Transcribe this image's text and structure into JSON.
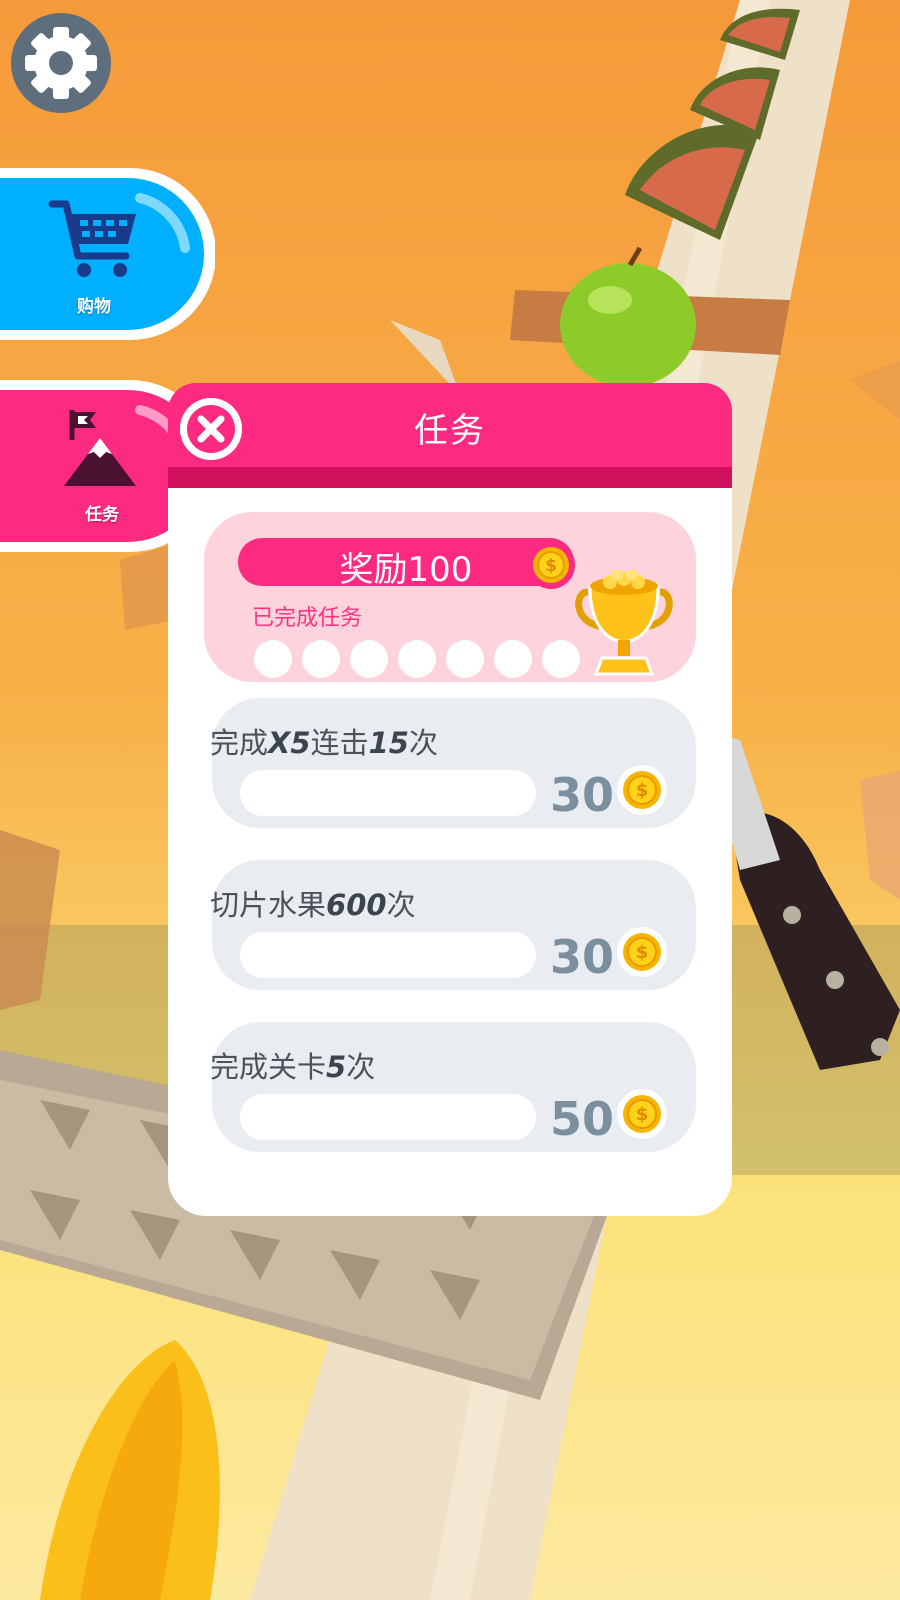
{
  "side_menu": {
    "shop_label": "购物",
    "tasks_label": "任务"
  },
  "icons": [
    "gear-icon",
    "shopping-cart-icon",
    "mountain-flag-icon",
    "close-icon",
    "coin-icon",
    "trophy-icon"
  ],
  "colors": {
    "shop_blue": "#00b0ff",
    "task_pink": "#fd2a82",
    "task_pink_dark": "#d0125e",
    "reward_card": "#ffd3dc",
    "task_card": "#e9edf2",
    "coin_gold": "#f7b500"
  },
  "panel": {
    "title": "任务",
    "reward": {
      "label": "奖励100",
      "completed_label": "已完成任务",
      "completed_count": 0,
      "total_slots": 7
    },
    "tasks": [
      {
        "pre": "完成",
        "em1": "X5",
        "mid": "连击",
        "em2": "15",
        "post": "次",
        "progress": 0,
        "reward": "30"
      },
      {
        "pre": "切片水果",
        "em1": "600",
        "mid": "次",
        "em2": "",
        "post": "",
        "progress": 0,
        "reward": "30"
      },
      {
        "pre": "完成关卡",
        "em1": "5",
        "mid": "次",
        "em2": "",
        "post": "",
        "progress": 0,
        "reward": "50"
      }
    ]
  }
}
